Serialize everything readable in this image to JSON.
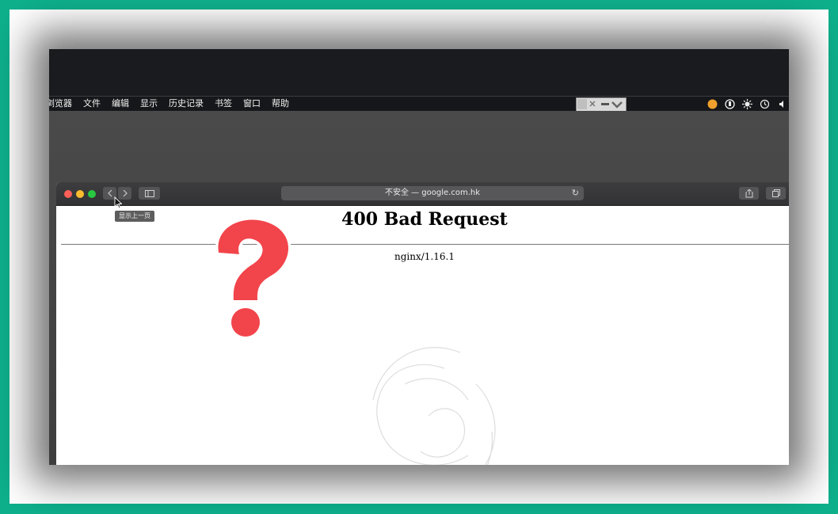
{
  "menubar": {
    "items": [
      "浏览器",
      "文件",
      "编辑",
      "显示",
      "历史记录",
      "书签",
      "窗口",
      "帮助"
    ]
  },
  "browser": {
    "address_text": "不安全 — google.com.hk",
    "tooltip": "显示上一页"
  },
  "page": {
    "heading": "400 Bad Request",
    "server": "nginx/1.16.1"
  },
  "colors": {
    "frame": "#0eb08c",
    "question_mark": "#f2444b",
    "close": "#fe5f57",
    "minimize": "#febc2e",
    "zoom": "#28c840"
  },
  "icons": [
    "back-chevron-icon",
    "forward-chevron-icon",
    "sidebar-icon",
    "reload-icon",
    "share-icon",
    "tabs-icon",
    "question-mark-icon",
    "pointer-cursor-icon"
  ]
}
